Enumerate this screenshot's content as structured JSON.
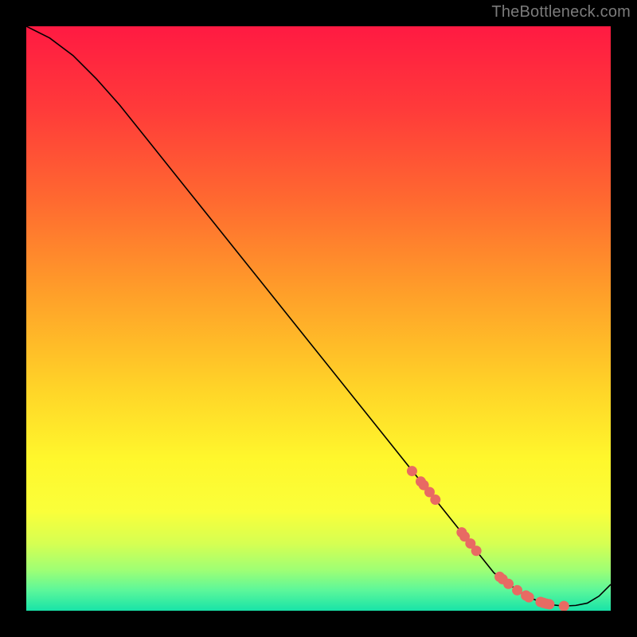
{
  "watermark": "TheBottleneck.com",
  "chart_data": {
    "type": "line",
    "title": "",
    "xlabel": "",
    "ylabel": "",
    "xlim": [
      0,
      100
    ],
    "ylim": [
      0,
      100
    ],
    "grid": false,
    "legend": false,
    "series": [
      {
        "name": "curve",
        "x": [
          0,
          4,
          8,
          12,
          16,
          20,
          24,
          28,
          32,
          36,
          40,
          44,
          48,
          52,
          56,
          60,
          64,
          68,
          72,
          76,
          80,
          82,
          84,
          86,
          88,
          90,
          92,
          94,
          96,
          98,
          100
        ],
        "values": [
          100,
          98,
          95,
          91,
          86.5,
          81.5,
          76.5,
          71.5,
          66.5,
          61.5,
          56.5,
          51.5,
          46.5,
          41.5,
          36.5,
          31.5,
          26.5,
          21.5,
          16.5,
          11.5,
          6.5,
          5.0,
          3.5,
          2.3,
          1.5,
          1.0,
          0.8,
          0.9,
          1.3,
          2.5,
          4.5
        ]
      }
    ],
    "markers": {
      "name": "highlight-points",
      "x": [
        66,
        67.5,
        68,
        69,
        70,
        74.5,
        75,
        76,
        77,
        81,
        81.5,
        82.5,
        84,
        85.5,
        86,
        88,
        88.5,
        89,
        89.5,
        92
      ],
      "y": [
        23.9,
        22.1,
        21.5,
        20.3,
        19.0,
        13.4,
        12.7,
        11.5,
        10.25,
        5.8,
        5.4,
        4.6,
        3.5,
        2.6,
        2.3,
        1.5,
        1.35,
        1.2,
        1.1,
        0.8
      ]
    },
    "gradient_stops": [
      {
        "offset": 0.0,
        "color": "#ff1a42"
      },
      {
        "offset": 0.14,
        "color": "#ff3a3a"
      },
      {
        "offset": 0.3,
        "color": "#ff6a30"
      },
      {
        "offset": 0.46,
        "color": "#ffa029"
      },
      {
        "offset": 0.62,
        "color": "#ffd428"
      },
      {
        "offset": 0.74,
        "color": "#fff72c"
      },
      {
        "offset": 0.83,
        "color": "#faff3a"
      },
      {
        "offset": 0.885,
        "color": "#d6ff52"
      },
      {
        "offset": 0.93,
        "color": "#9fff74"
      },
      {
        "offset": 0.965,
        "color": "#5cf79a"
      },
      {
        "offset": 1.0,
        "color": "#18e3a8"
      }
    ],
    "marker_color": "#e86a63",
    "line_color": "#000000"
  }
}
